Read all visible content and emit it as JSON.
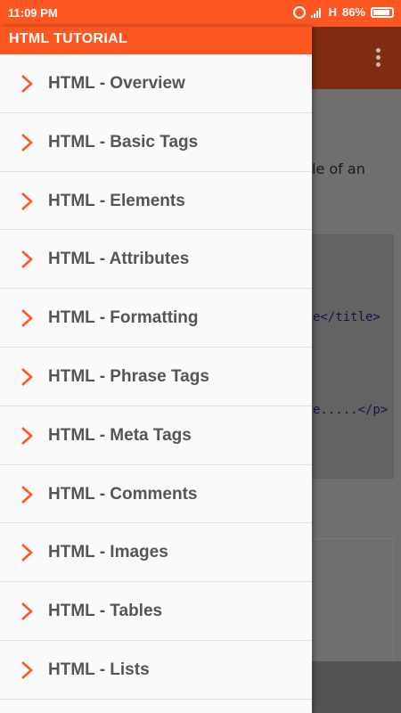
{
  "status_bar": {
    "time": "11:09 PM",
    "network": "H",
    "battery": "86%"
  },
  "drawer": {
    "title": "HTML TUTORIAL",
    "items": [
      {
        "label": "HTML - Overview"
      },
      {
        "label": "HTML - Basic Tags"
      },
      {
        "label": "HTML - Elements"
      },
      {
        "label": "HTML - Attributes"
      },
      {
        "label": "HTML - Formatting"
      },
      {
        "label": "HTML - Phrase Tags"
      },
      {
        "label": "HTML - Meta Tags"
      },
      {
        "label": "HTML - Comments"
      },
      {
        "label": "HTML - Images"
      },
      {
        "label": "HTML - Tables"
      },
      {
        "label": "HTML - Lists"
      }
    ]
  },
  "background": {
    "text_fragment": "le of an",
    "code_line_1": "e</title>",
    "code_line_2": "e.....</p>"
  },
  "colors": {
    "accent": "#ff5722",
    "chevron": "#ff5722",
    "item_text": "#555555"
  }
}
